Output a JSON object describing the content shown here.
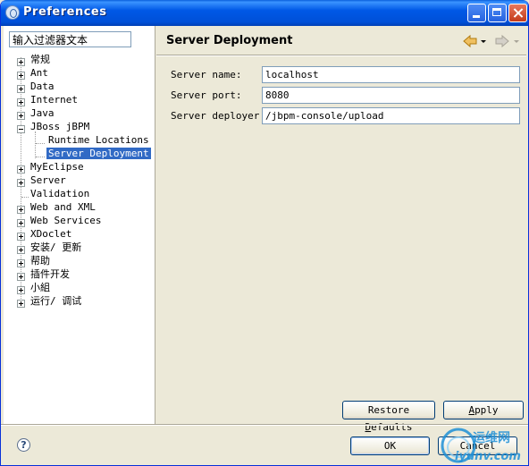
{
  "window": {
    "title": "Preferences"
  },
  "filter": {
    "value": "输入过滤器文本"
  },
  "tree": {
    "items": [
      {
        "label": "常规"
      },
      {
        "label": "Ant"
      },
      {
        "label": "Data"
      },
      {
        "label": "Internet"
      },
      {
        "label": "Java"
      },
      {
        "label": "JBoss jBPM"
      },
      {
        "label": "Runtime Locations"
      },
      {
        "label": "Server Deployment"
      },
      {
        "label": "MyEclipse"
      },
      {
        "label": "Server"
      },
      {
        "label": "Validation"
      },
      {
        "label": "Web and XML"
      },
      {
        "label": "Web Services"
      },
      {
        "label": "XDoclet"
      },
      {
        "label": "安装/ 更新"
      },
      {
        "label": "帮助"
      },
      {
        "label": "插件开发"
      },
      {
        "label": "小組"
      },
      {
        "label": "运行/ 调试"
      }
    ]
  },
  "page": {
    "title": "Server Deployment"
  },
  "fields": [
    {
      "label": "Server name:",
      "value": "localhost"
    },
    {
      "label": "Server port:",
      "value": "8080"
    },
    {
      "label": "Server deployer:",
      "value": "/jbpm-console/upload"
    }
  ],
  "buttons": {
    "restore_pre": "Restore ",
    "restore_ul": "D",
    "restore_post": "efaults",
    "apply_ul": "A",
    "apply_post": "pply",
    "ok": "OK",
    "cancel": "Cancel"
  },
  "help": {
    "glyph": "?"
  },
  "watermark": {
    "line1": "运维网",
    "line2": "iyunv.com"
  },
  "colors": {
    "title_bar": "#0054e3",
    "selection": "#316ac5",
    "watermark": "#1e8fd6"
  }
}
